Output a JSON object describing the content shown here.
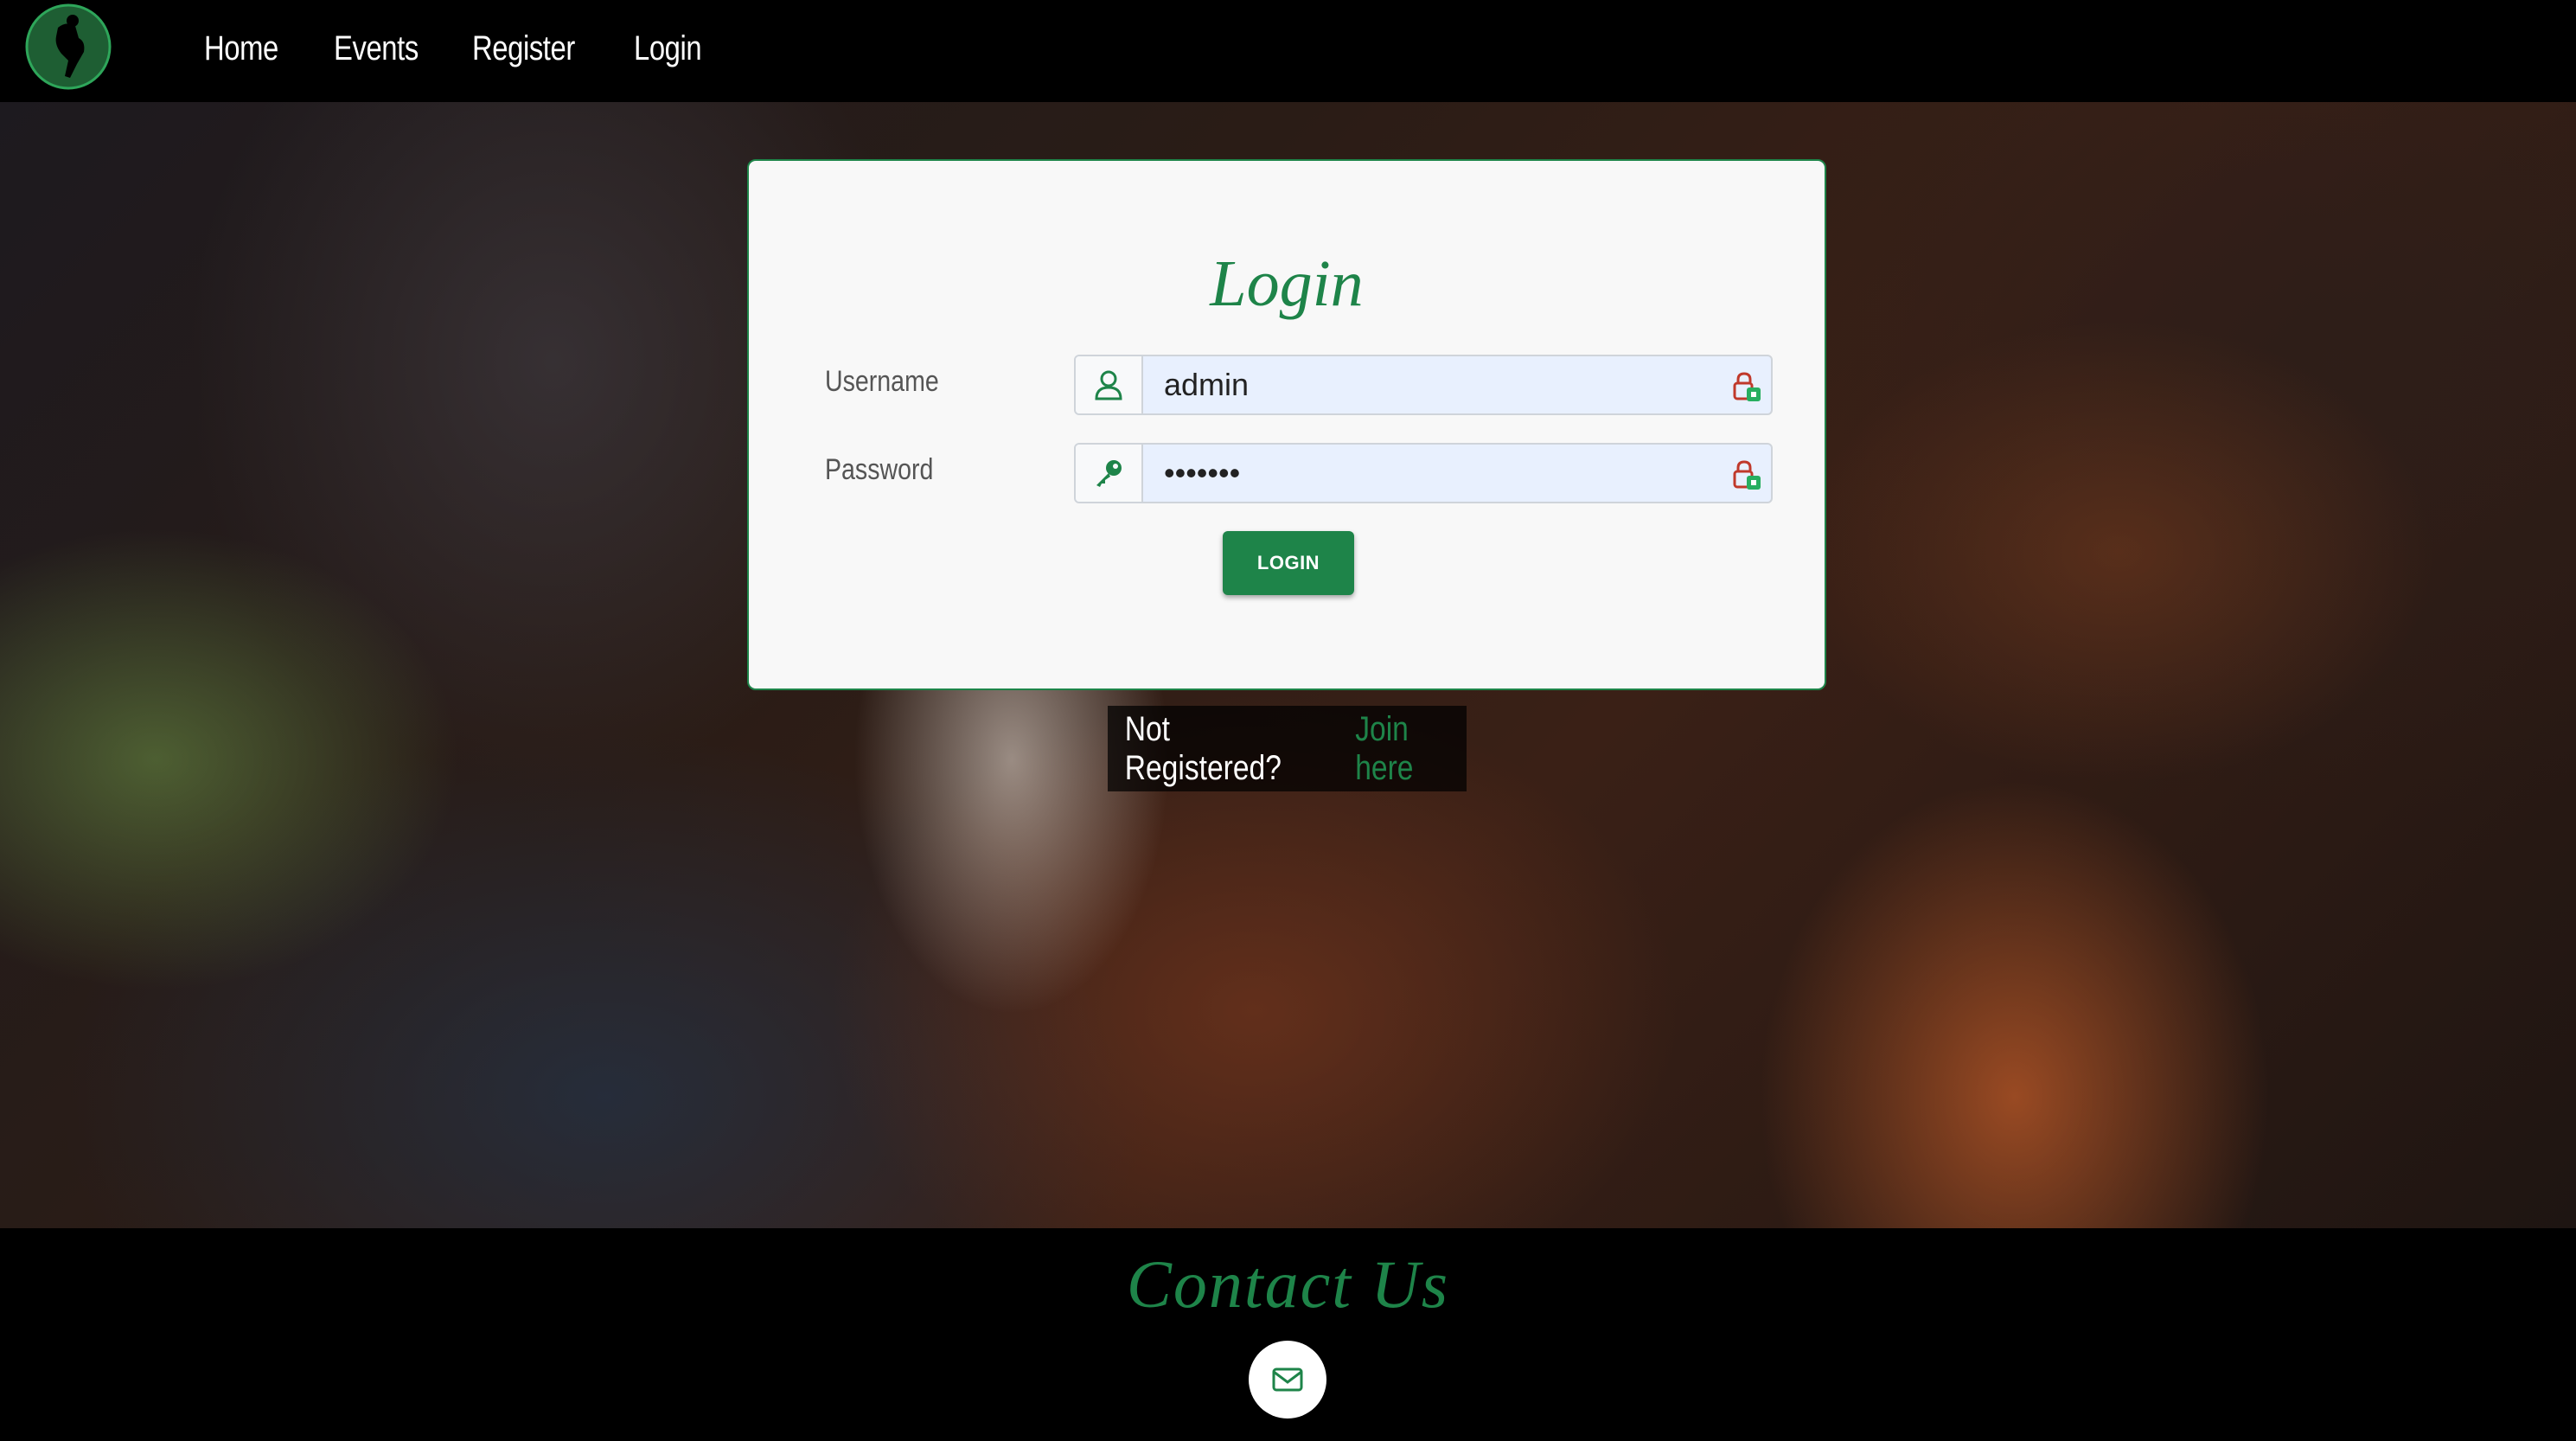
{
  "nav": {
    "logo_icon": "climber-logo-icon",
    "links": [
      "Home",
      "Events",
      "Register",
      "Login"
    ]
  },
  "login": {
    "title": "Login",
    "username_label": "Username",
    "username_value": "admin",
    "password_label": "Password",
    "password_value": "•••••••",
    "submit_label": "LOGIN"
  },
  "register": {
    "prompt": "Not Registered?",
    "link": "Join here"
  },
  "footer": {
    "title": "Contact Us",
    "mail_icon": "envelope-icon"
  },
  "colors": {
    "accent": "#1e8449",
    "nav_bg": "#000000",
    "input_autofill": "#e8f0fe"
  }
}
